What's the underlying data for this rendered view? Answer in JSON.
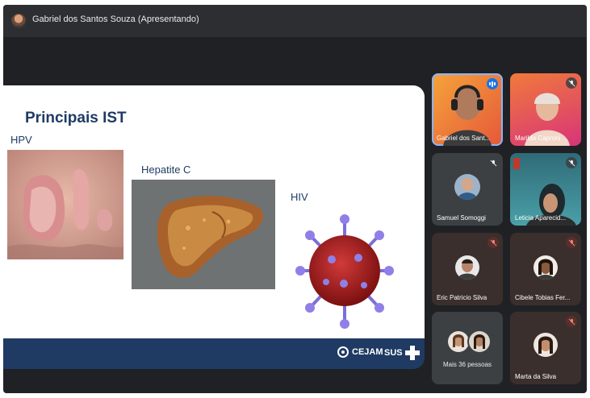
{
  "presenter": {
    "label": "Gabriel dos Santos Souza (Apresentando)"
  },
  "slide": {
    "title": "Principais IST",
    "items": [
      {
        "label": "HPV"
      },
      {
        "label": "Hepatite C"
      },
      {
        "label": "HIV"
      }
    ],
    "footer": {
      "org": "CEJAM",
      "sus": "SUS"
    }
  },
  "participants": [
    {
      "name": "Gabriel dos Sant...",
      "status": "speaking"
    },
    {
      "name": "Marilda Caproni ...",
      "status": "muted"
    },
    {
      "name": "Samuel Somoggi",
      "status": "muted"
    },
    {
      "name": "Leticia Aparecid...",
      "status": "muted"
    },
    {
      "name": "Eric Patricio Silva",
      "status": "muted"
    },
    {
      "name": "Cibele Tobias Fer...",
      "status": "muted"
    },
    {
      "name": "Mais 36 pessoas",
      "status": ""
    },
    {
      "name": "Marta da Silva",
      "status": "muted"
    }
  ],
  "colors": {
    "speaking_outline": "#8ab4f8",
    "slide_navy": "#1f3b63",
    "stage_bg": "#202124"
  }
}
